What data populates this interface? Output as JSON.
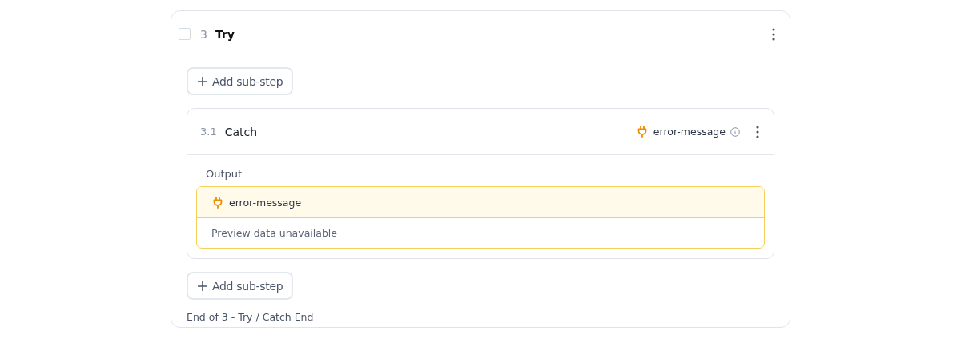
{
  "step": {
    "checked": false,
    "number": "3",
    "title": "Try"
  },
  "add_sub_step_top": {
    "label": "Add sub-step"
  },
  "sub_step": {
    "number": "3.1",
    "title": "Catch",
    "variable": "error-message",
    "output": {
      "label": "Output",
      "variable": "error-message",
      "preview": "Preview data unavailable"
    }
  },
  "add_sub_step_bottom": {
    "label": "Add sub-step"
  },
  "footer": "End of 3 - Try / Catch End"
}
